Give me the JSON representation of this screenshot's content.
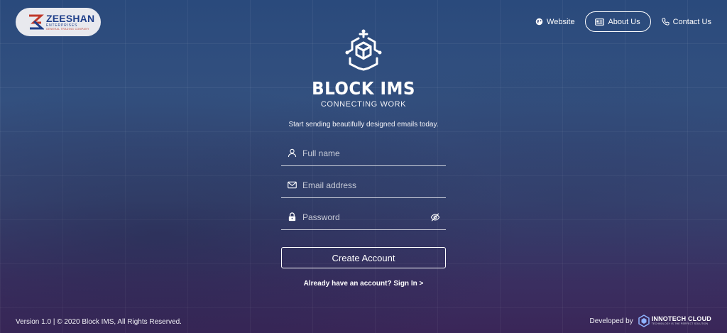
{
  "header": {
    "logo": {
      "name": "ZEESHAN",
      "sub": "ENTERPRISES",
      "tag": "GENERAL TRADING COMPANY"
    },
    "nav": {
      "website": "Website",
      "about": "About Us",
      "contact": "Contact Us"
    }
  },
  "brand": {
    "title": "BLOCK IMS",
    "tagline": "CONNECTING WORK"
  },
  "form": {
    "intro": "Start sending beautifully designed emails today.",
    "full_name_placeholder": "Full name",
    "email_placeholder": "Email address",
    "password_placeholder": "Password",
    "full_name_value": "",
    "email_value": "",
    "password_value": "",
    "create_label": "Create Account",
    "signin_prompt": "Already have an account?",
    "signin_label": "Sign In >"
  },
  "footer": {
    "copyright": "Version 1.0 | © 2020 Block IMS, All Rights Reserved.",
    "developed_by": "Developed by",
    "developer_name": "INNOTECH CLOUD",
    "developer_tag": "TECHNOLOGY IS THE PERFECT SOLUTION"
  },
  "colors": {
    "background_top": "#2a4a7c",
    "background_bottom": "#3a2658",
    "logo_blue": "#1f3f8a",
    "logo_red": "#c0392b",
    "text": "#ffffff"
  },
  "icons": {
    "website": "globe-icon",
    "about": "id-card-icon",
    "contact": "phone-icon",
    "name_field": "user-icon",
    "email_field": "mail-icon",
    "password_field": "lock-icon",
    "password_toggle": "eye-off-icon",
    "brand": "cube-network-icon"
  }
}
